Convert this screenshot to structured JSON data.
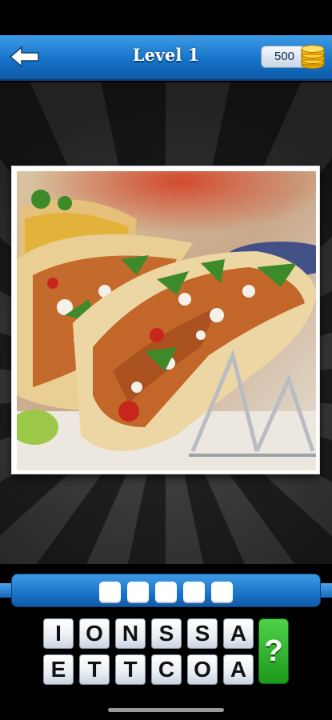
{
  "header": {
    "title": "Level 1",
    "back_icon": "back-arrow-icon"
  },
  "coins": {
    "value": "500",
    "icon": "coin-stack-icon"
  },
  "puzzle": {
    "photo_icon": "tacos-photo",
    "answer_length": 5,
    "answer_slots": [
      "",
      "",
      "",
      "",
      ""
    ]
  },
  "letters": {
    "row1": [
      "I",
      "O",
      "N",
      "S",
      "S",
      "A"
    ],
    "row2": [
      "E",
      "T",
      "T",
      "C",
      "O",
      "A"
    ]
  },
  "hint": {
    "label": "?"
  },
  "colors": {
    "accent": "#1673c8",
    "hint": "#2aae27"
  }
}
